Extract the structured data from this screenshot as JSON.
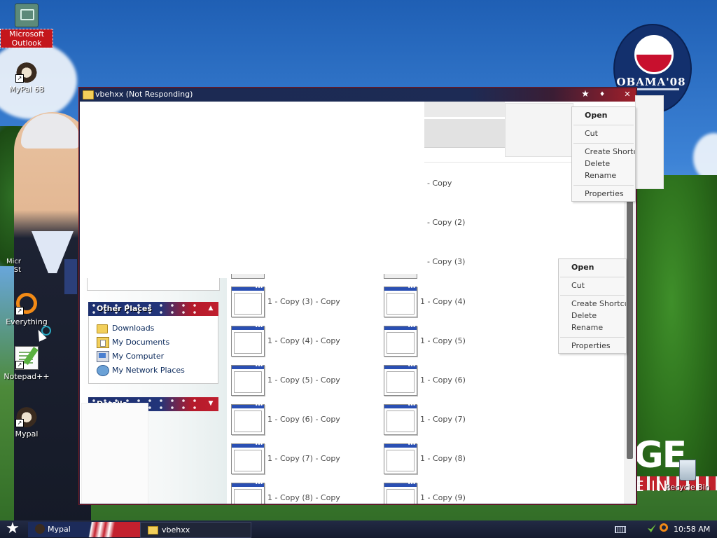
{
  "desktop": {
    "icons": [
      {
        "label": "Microsoft Outlook",
        "icon": "outlook-icon",
        "selected": true
      },
      {
        "label": "MyPal 68",
        "icon": "raccoon-icon"
      },
      {
        "label": "Everything",
        "icon": "everything-search-icon"
      },
      {
        "label": "Notepad++",
        "icon": "notepad-plus-plus-icon"
      },
      {
        "label": "Mypal",
        "icon": "raccoon-icon"
      }
    ],
    "partial_label": "Micr\nSt",
    "recycle_bin_label": "Recycle Bin",
    "background_logo_text": "OBAMA'08",
    "background_big_text": "GE",
    "background_sub_text": "E IN"
  },
  "window": {
    "title": "vbehxx (Not Responding)",
    "title_buttons": [
      "★",
      "♦",
      "✕"
    ],
    "task_pane": {
      "other_places": {
        "header": "Other Places",
        "links": [
          {
            "label": "Downloads",
            "icon": "folder-icon"
          },
          {
            "label": "My Documents",
            "icon": "my-documents-icon"
          },
          {
            "label": "My Computer",
            "icon": "my-computer-icon"
          },
          {
            "label": "My Network Places",
            "icon": "network-places-icon"
          }
        ]
      },
      "details": {
        "header": "Details"
      }
    },
    "files_col2_top": [
      "- Copy",
      "- Copy (2)",
      "- Copy (3)"
    ],
    "files_col1": [
      "1 - Copy (3) - Copy",
      "1 - Copy (4) - Copy",
      "1 - Copy (5) - Copy",
      "1 - Copy (6) - Copy",
      "1 - Copy (7) - Copy",
      "1 - Copy (8) - Copy"
    ],
    "files_col2": [
      "1 - Copy (4)",
      "1 - Copy (5)",
      "1 - Copy (6)",
      "1 - Copy (7)",
      "1 - Copy (8)",
      "1 - Copy (9)"
    ]
  },
  "context_menu_1": {
    "items": [
      "Open",
      "Cut",
      "Create Shortcut",
      "Delete",
      "Rename",
      "Properties"
    ]
  },
  "context_menu_2": {
    "items": [
      "Open",
      "Cut",
      "Create Shortcut",
      "Delete",
      "Rename",
      "Properties"
    ]
  },
  "taskbar": {
    "start_glyph": "★",
    "tasks": [
      {
        "label": "Mypal",
        "icon": "raccoon-icon"
      },
      {
        "label": "vbehxx",
        "icon": "folder-icon",
        "active": true
      }
    ],
    "clock": "10:58 AM"
  }
}
